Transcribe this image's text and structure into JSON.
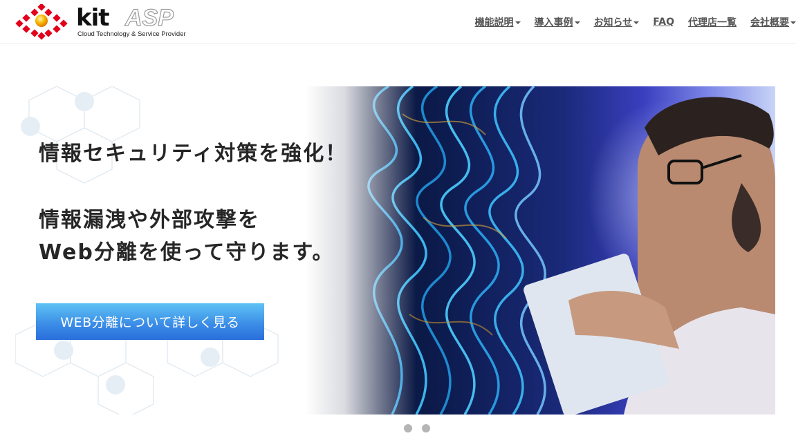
{
  "brand": {
    "kit": "kit",
    "asp": "ASP",
    "tagline": "Cloud Technology & Service Provider"
  },
  "nav": {
    "items": [
      {
        "label": "機能説明",
        "dropdown": true
      },
      {
        "label": "導入事例",
        "dropdown": true
      },
      {
        "label": "お知らせ",
        "dropdown": true
      },
      {
        "label": "FAQ",
        "dropdown": false
      },
      {
        "label": "代理店一覧",
        "dropdown": false
      },
      {
        "label": "会社概要",
        "dropdown": true
      }
    ]
  },
  "hero": {
    "headline_1": "情報セキュリティ対策を強化！",
    "headline_2": "情報漏洩や外部攻撃を",
    "headline_3": "Web分離を使って守ります。",
    "cta_label": "WEB分離について詳しく見る"
  },
  "carousel": {
    "slide_count": 2
  },
  "colors": {
    "logo_red": "#e3001b",
    "logo_yellow": "#f7b500",
    "cta_top": "#5ec3f4",
    "cta_bottom": "#2a6fdc",
    "nav_text": "#555555"
  }
}
